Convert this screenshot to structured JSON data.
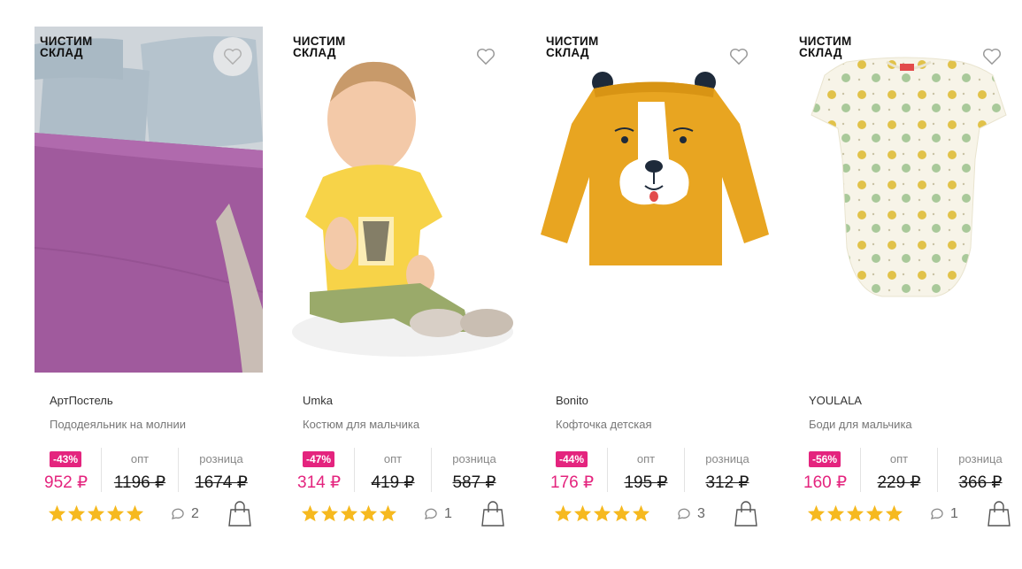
{
  "colors": {
    "accent": "#e4247e",
    "star": "#f6b91f",
    "old_price": "#1a1a1a"
  },
  "products": [
    {
      "badge": "ЧИСТИМ\nСКЛАД",
      "brand": "АртПостель",
      "title": "Пододеяльник на молнии",
      "discount": "-43%",
      "price": "952 ₽",
      "opt_label": "опт",
      "opt_price": "1196 ₽",
      "retail_label": "розница",
      "retail_price": "1674 ₽",
      "rating": 5,
      "comments": "2",
      "favorite_icon": "heart-icon"
    },
    {
      "badge": "ЧИСТИМ\nСКЛАД",
      "brand": "Umka",
      "title": "Костюм для мальчика",
      "discount": "-47%",
      "price": "314 ₽",
      "opt_label": "опт",
      "opt_price": "419 ₽",
      "retail_label": "розница",
      "retail_price": "587 ₽",
      "rating": 5,
      "comments": "1",
      "favorite_icon": "heart-icon"
    },
    {
      "badge": "ЧИСТИМ\nСКЛАД",
      "brand": "Bonito",
      "title": "Кофточка детская",
      "discount": "-44%",
      "price": "176 ₽",
      "opt_label": "опт",
      "opt_price": "195 ₽",
      "retail_label": "розница",
      "retail_price": "312 ₽",
      "rating": 5,
      "comments": "3",
      "favorite_icon": "heart-icon"
    },
    {
      "badge": "ЧИСТИМ\nСКЛАД",
      "brand": "YOULALA",
      "title": "Боди для мальчика",
      "discount": "-56%",
      "price": "160 ₽",
      "opt_label": "опт",
      "opt_price": "229 ₽",
      "retail_label": "розница",
      "retail_price": "366 ₽",
      "rating": 5,
      "comments": "1",
      "favorite_icon": "heart-icon"
    }
  ]
}
